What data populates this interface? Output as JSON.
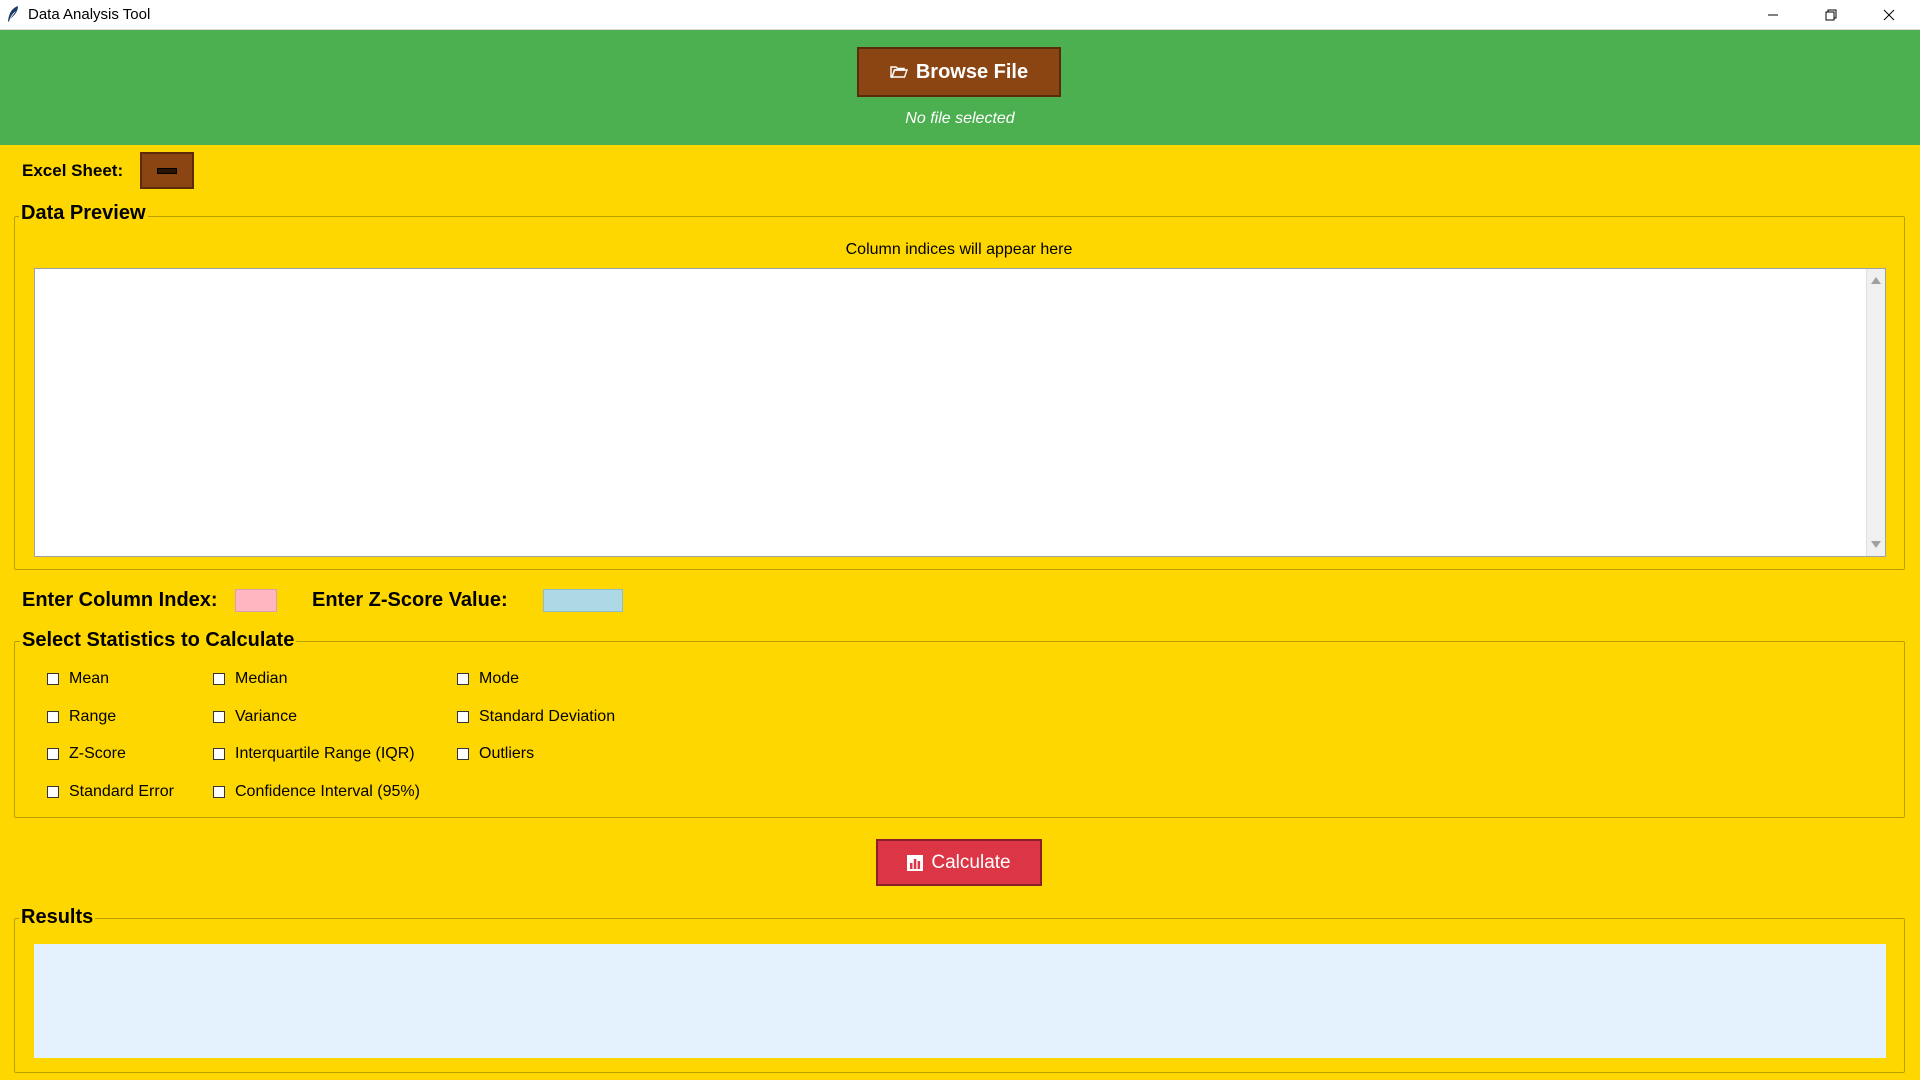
{
  "window": {
    "title": "Data Analysis Tool",
    "icons": [
      "feather-icon",
      "minimize-icon",
      "restore-icon",
      "close-icon"
    ]
  },
  "header": {
    "browse_label": "Browse File",
    "browse_icon": "folder-open-icon",
    "file_status": "No file selected",
    "background": "#4CAF50",
    "button_color": "#8B4513"
  },
  "sheet": {
    "label": "Excel Sheet:"
  },
  "preview": {
    "legend": "Data Preview",
    "column_indices": "Column indices will appear here",
    "content": ""
  },
  "inputs": {
    "column_index_label": "Enter Column Index:",
    "column_index_value": "",
    "zscore_label": "Enter Z-Score Value:",
    "zscore_value": "",
    "column_index_color": "#FFB6C1",
    "zscore_color": "#ADD8E6"
  },
  "stats": {
    "legend": "Select Statistics to Calculate",
    "options": [
      {
        "label": "Mean",
        "checked": false
      },
      {
        "label": "Median",
        "checked": false
      },
      {
        "label": "Mode",
        "checked": false
      },
      {
        "label": "Range",
        "checked": false
      },
      {
        "label": "Variance",
        "checked": false
      },
      {
        "label": "Standard Deviation",
        "checked": false
      },
      {
        "label": "Z-Score",
        "checked": false
      },
      {
        "label": "Interquartile Range (IQR)",
        "checked": false
      },
      {
        "label": "Outliers",
        "checked": false
      },
      {
        "label": "Standard Error",
        "checked": false
      },
      {
        "label": "Confidence Interval (95%)",
        "checked": false
      }
    ]
  },
  "calculate": {
    "label": "Calculate",
    "icon": "bar-chart-icon",
    "color": "#DC3545"
  },
  "results": {
    "legend": "Results",
    "content": "",
    "background": "#E3F2FD"
  },
  "theme": {
    "background": "#FFD700"
  }
}
